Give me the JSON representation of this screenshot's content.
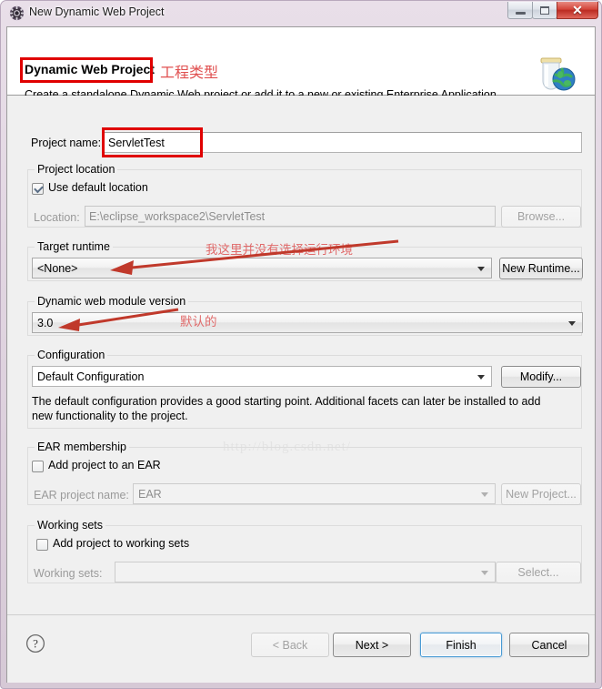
{
  "window": {
    "title": "New Dynamic Web Project",
    "icon": "gear-icon",
    "controls": {
      "minimize": "—",
      "maximize": "□",
      "close": "✕"
    }
  },
  "banner": {
    "title": "Dynamic Web Project",
    "title_annotation": "工程类型",
    "description": "Create a standalone Dynamic Web project or add it to a new or existing Enterprise Application.",
    "icon": "jar-globe-icon"
  },
  "project_name": {
    "label": "Project name:",
    "value": "ServletTest"
  },
  "project_location": {
    "group_title": "Project location",
    "use_default_label": "Use default location",
    "use_default_checked": true,
    "location_label": "Location:",
    "location_value": "E:\\eclipse_workspace2\\ServletTest",
    "browse_label": "Browse..."
  },
  "target_runtime": {
    "group_title": "Target runtime",
    "value": "<None>",
    "new_runtime_label": "New Runtime...",
    "annotation": "我这里并没有选择运行环境"
  },
  "module_version": {
    "group_title": "Dynamic web module version",
    "value": "3.0",
    "annotation": "默认的"
  },
  "configuration": {
    "group_title": "Configuration",
    "value": "Default Configuration",
    "modify_label": "Modify...",
    "description_line1": "The default configuration provides a good starting point. Additional facets can later be installed to add",
    "description_line2": "new functionality to the project."
  },
  "ear_membership": {
    "group_title": "EAR membership",
    "add_to_ear_label": "Add project to an EAR",
    "add_to_ear_checked": false,
    "ear_project_name_label": "EAR project name:",
    "ear_project_name_value": "EAR",
    "new_project_label": "New Project..."
  },
  "working_sets": {
    "group_title": "Working sets",
    "add_label": "Add project to working sets",
    "add_checked": false,
    "working_sets_label": "Working sets:",
    "working_sets_value": "",
    "select_label": "Select..."
  },
  "footer": {
    "help_icon": "question-mark-icon",
    "back_label": "< Back",
    "next_label": "Next >",
    "finish_label": "Finish",
    "cancel_label": "Cancel"
  },
  "watermark": {
    "text": "http://blog.csdn.net/"
  },
  "colors": {
    "annotation_red": "#e00000",
    "annotation_text": "#e06a6a",
    "default_button_border": "#4a9bd4"
  }
}
